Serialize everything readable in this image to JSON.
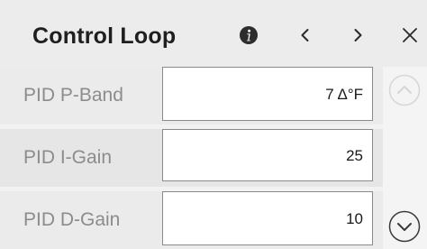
{
  "header": {
    "title": "Control Loop"
  },
  "icons": {
    "info": "info-icon",
    "prev": "chevron-left-icon",
    "next": "chevron-right-icon",
    "close": "close-icon",
    "scroll_up": "chevron-up-circle-icon",
    "scroll_down": "chevron-down-circle-icon"
  },
  "rows": [
    {
      "label": "PID P-Band",
      "value": "7 Δ°F"
    },
    {
      "label": "PID I-Gain",
      "value": "25"
    },
    {
      "label": "PID D-Gain",
      "value": "10"
    }
  ],
  "colors": {
    "header_bg": "#ececec",
    "label_text": "#8c8c8c",
    "disabled_control": "#d6d6d6",
    "active_control": "#3a3a3a"
  }
}
